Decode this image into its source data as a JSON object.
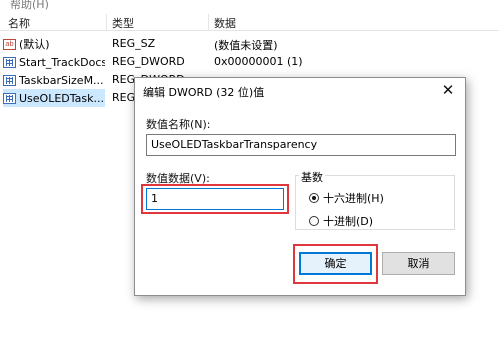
{
  "menu": {
    "help_label": "帮助(H)"
  },
  "list": {
    "columns": {
      "name": "名称",
      "type": "类型",
      "data": "数据"
    },
    "rows": [
      {
        "name": "(默认)",
        "type": "REG_SZ",
        "data": "(数值未设置)",
        "icon": "string-value-icon"
      },
      {
        "name": "Start_TrackDocs",
        "type": "REG_DWORD",
        "data": "0x00000001 (1)",
        "icon": "binary-value-icon"
      },
      {
        "name": "TaskbarSizeM...",
        "type": "REG_DWORD",
        "data": "",
        "icon": "binary-value-icon"
      },
      {
        "name": "UseOLEDTask...",
        "type": "REG_",
        "data": "",
        "icon": "binary-value-icon",
        "selected": true
      }
    ]
  },
  "dialog": {
    "title": "编辑 DWORD (32 位)值",
    "close_glyph": "✕",
    "value_name_label": "数值名称(N):",
    "value_name": "UseOLEDTaskbarTransparency",
    "value_data_label": "数值数据(V):",
    "value_data": "1",
    "base_label": "基数",
    "radio_hex": "十六进制(H)",
    "radio_dec": "十进制(D)",
    "base_selected": "hex",
    "ok_label": "确定",
    "cancel_label": "取消"
  },
  "colors": {
    "annotation": "#e0373f",
    "selection": "#cce8ff",
    "focus": "#0078d7"
  }
}
